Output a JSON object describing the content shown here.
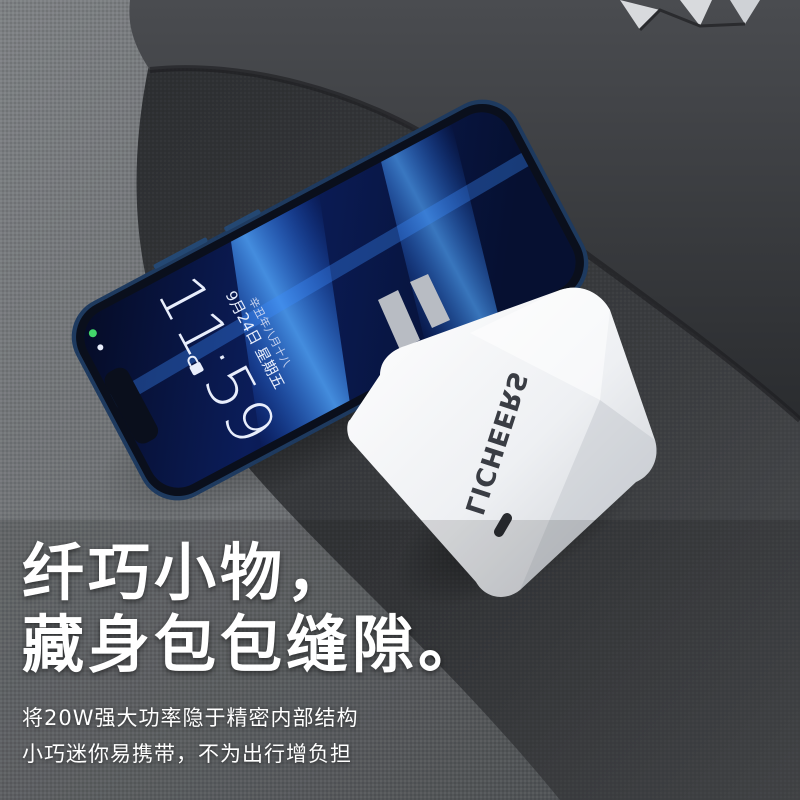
{
  "phone": {
    "time": "11:59",
    "date": "9月24日 星期五",
    "lunar": "辛丑年八月十八"
  },
  "charger": {
    "brand": "LICHEERS"
  },
  "copy": {
    "headline_1": "纤巧小物，",
    "headline_2": "藏身包包缝隙。",
    "subline_1": "将20W强大功率隐于精密内部结构",
    "subline_2": "小巧迷你易携带，不为出行增负担"
  },
  "colors": {
    "fabric_dark": "#3a3c3f",
    "fabric_light": "#8a8d90",
    "phone_frame": "#1e3a5f",
    "screen_glow": "#1e6bff",
    "charger_white": "#f2f3f5",
    "text": "#ffffff"
  }
}
